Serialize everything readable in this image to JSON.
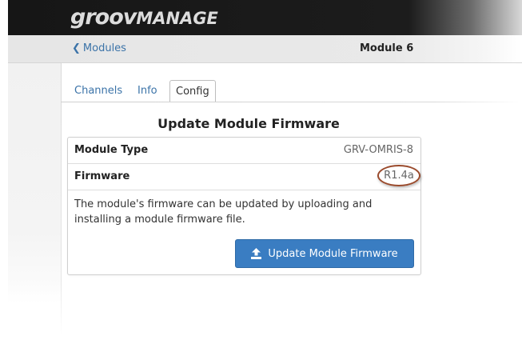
{
  "header": {
    "logo_primary": "groov",
    "logo_secondary": "MANAGE"
  },
  "navbar": {
    "back_label": "Modules",
    "page_title": "Module 6"
  },
  "tabs": [
    {
      "label": "Channels"
    },
    {
      "label": "Info"
    },
    {
      "label": "Config"
    }
  ],
  "active_tab": "Config",
  "config": {
    "section_title": "Update Module Firmware",
    "rows": [
      {
        "label": "Module Type",
        "value": "GRV-OMRIS-8"
      },
      {
        "label": "Firmware",
        "value": "R1.4a"
      }
    ],
    "description": "The module's firmware can be updated by uploading and installing a module firmware file.",
    "button_label": "Update Module Firmware",
    "button_icon": "upload-icon"
  },
  "colors": {
    "accent": "#3a7dc2",
    "link": "#3b73a8",
    "highlight_circle": "#9a4a2c"
  }
}
